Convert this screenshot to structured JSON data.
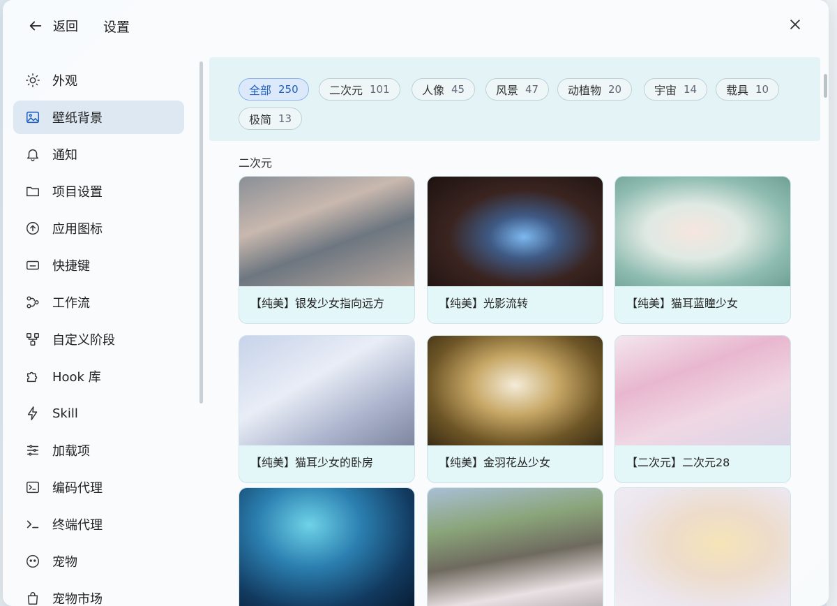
{
  "header": {
    "back_label": "返回",
    "title": "设置"
  },
  "sidebar": {
    "items": [
      {
        "label": "外观",
        "icon": "sun-icon"
      },
      {
        "label": "壁纸背景",
        "icon": "image-icon",
        "active": true
      },
      {
        "label": "通知",
        "icon": "bell-icon"
      },
      {
        "label": "项目设置",
        "icon": "folder-icon"
      },
      {
        "label": "应用图标",
        "icon": "upload-circle-icon"
      },
      {
        "label": "快捷键",
        "icon": "keyboard-icon"
      },
      {
        "label": "工作流",
        "icon": "workflow-icon"
      },
      {
        "label": "自定义阶段",
        "icon": "stages-icon"
      },
      {
        "label": "Hook 库",
        "icon": "puzzle-icon"
      },
      {
        "label": "Skill",
        "icon": "lightning-icon"
      },
      {
        "label": "加载项",
        "icon": "sliders-icon"
      },
      {
        "label": "编码代理",
        "icon": "terminal-box-icon"
      },
      {
        "label": "终端代理",
        "icon": "prompt-icon"
      },
      {
        "label": "宠物",
        "icon": "pet-icon"
      },
      {
        "label": "宠物市场",
        "icon": "bag-icon"
      }
    ]
  },
  "filters": [
    {
      "label": "全部",
      "count": "250",
      "active": true
    },
    {
      "label": "二次元",
      "count": "101"
    },
    {
      "label": "人像",
      "count": "45"
    },
    {
      "label": "风景",
      "count": "47"
    },
    {
      "label": "动植物",
      "count": "20"
    },
    {
      "label": "宇宙",
      "count": "14"
    },
    {
      "label": "载具",
      "count": "10"
    },
    {
      "label": "极简",
      "count": "13"
    }
  ],
  "section_title": "二次元",
  "wallpapers": [
    {
      "caption": "【纯美】银发少女指向远方"
    },
    {
      "caption": "【纯美】光影流转"
    },
    {
      "caption": "【纯美】猫耳蓝瞳少女"
    },
    {
      "caption": "【纯美】猫耳少女的卧房"
    },
    {
      "caption": "【纯美】金羽花丛少女"
    },
    {
      "caption": "【二次元】二次元28"
    },
    {
      "caption": ""
    },
    {
      "caption": ""
    },
    {
      "caption": ""
    }
  ]
}
